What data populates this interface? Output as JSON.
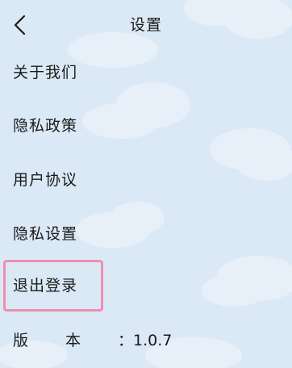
{
  "header": {
    "title": "设置",
    "back_icon": "chevron-left-icon"
  },
  "menu": {
    "items": [
      {
        "label": "关于我们"
      },
      {
        "label": "隐私政策"
      },
      {
        "label": "用户协议"
      },
      {
        "label": "隐私设置"
      },
      {
        "label": "退出登录"
      }
    ]
  },
  "version": {
    "label": "版本",
    "value": "1.0.7"
  },
  "colors": {
    "background": "#dbe9f6",
    "cloud": "#ffffff",
    "highlight": "#ef8fb0",
    "text": "#1a1a1a"
  }
}
